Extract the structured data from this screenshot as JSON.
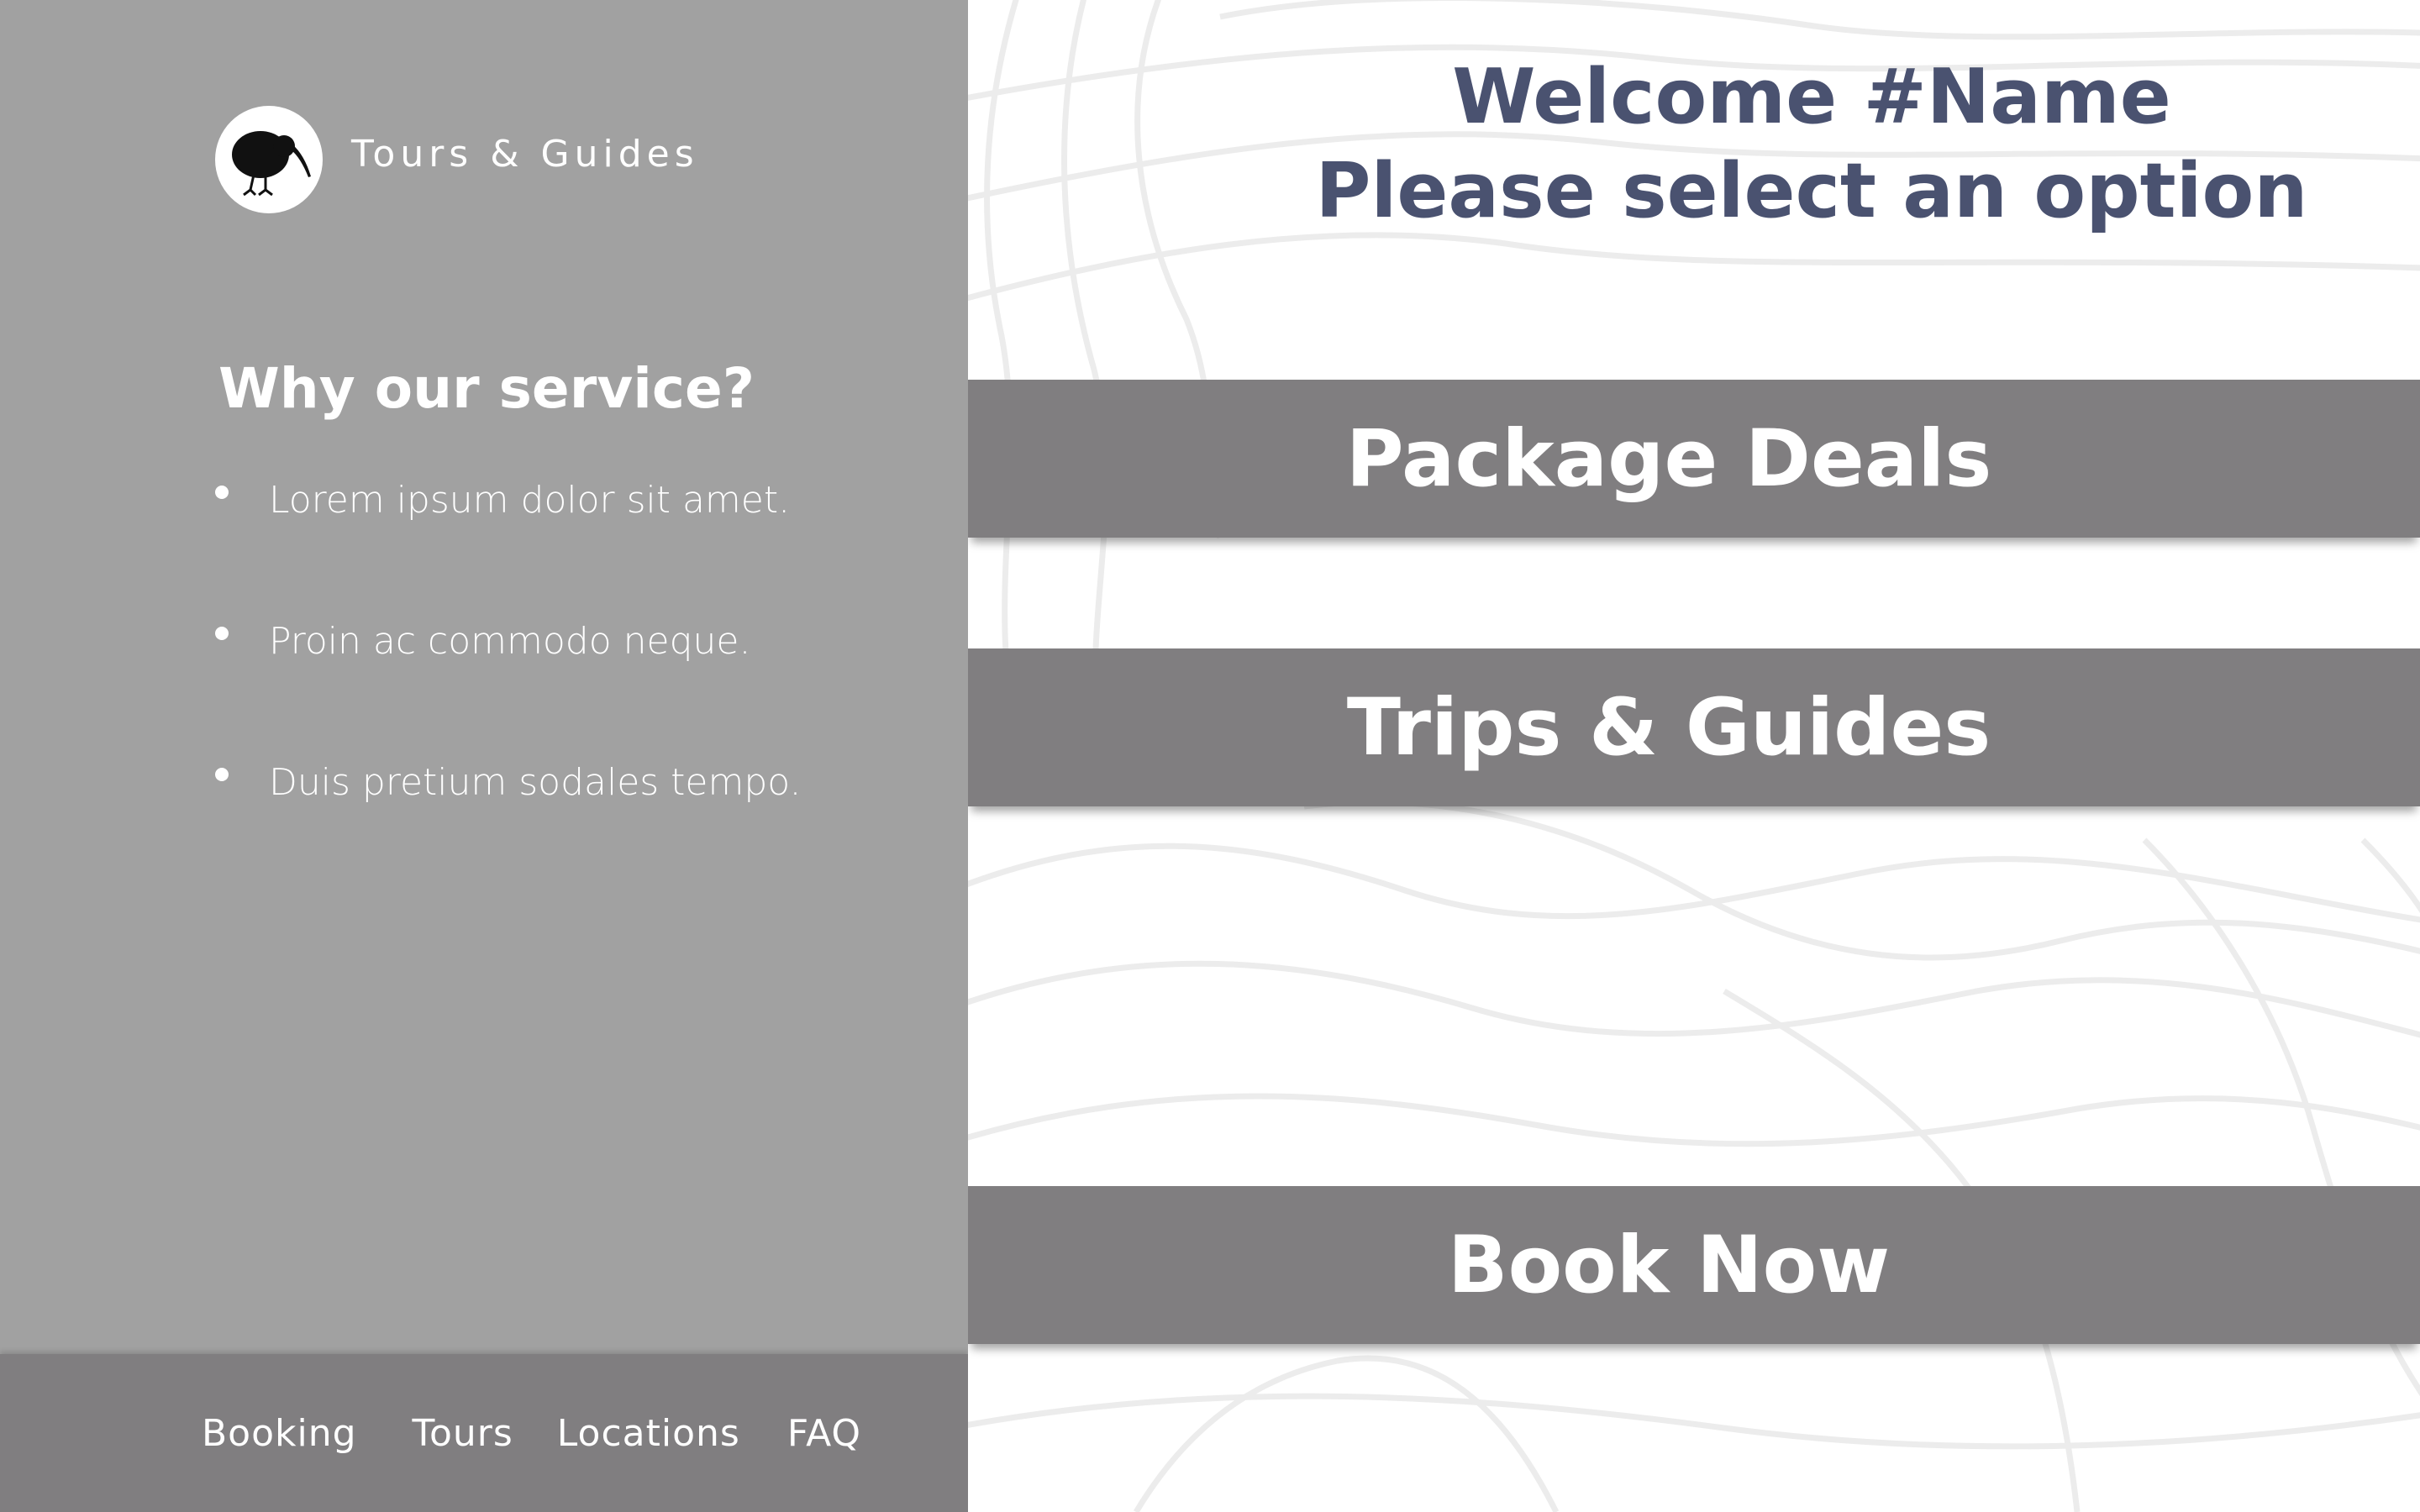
{
  "brand": {
    "name": "Tours & Guides",
    "logo_icon": "kiwi-bird-icon"
  },
  "sidebar": {
    "why_title": "Why our service?",
    "features": [
      "Lorem ipsum dolor sit amet.",
      "Proin ac commodo neque.",
      "Duis pretium sodales tempo."
    ]
  },
  "footer_nav": {
    "links": [
      "Booking",
      "Tours",
      "Locations",
      "FAQ"
    ]
  },
  "welcome": {
    "line1": "Welcome #Name",
    "line2": "Please select an option"
  },
  "options": {
    "package_deals": "Package Deals",
    "trips_guides": "Trips & Guides",
    "book_now": "Book Now"
  },
  "colors": {
    "sidebar_bg": "#a1a1a1",
    "button_bg": "#807e80",
    "heading_text": "#4a5270",
    "topo_lines": "#ececec"
  }
}
